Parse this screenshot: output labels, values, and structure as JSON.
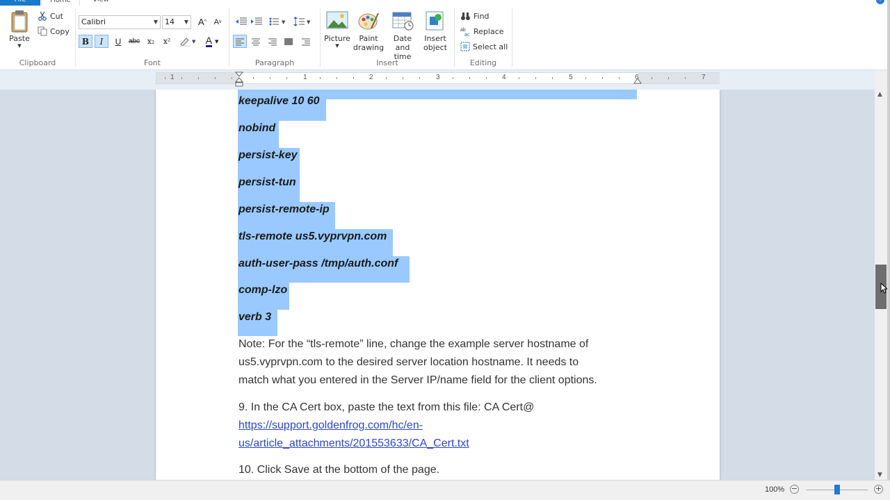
{
  "tabs": {
    "file": "File",
    "home": "Home",
    "view": "View"
  },
  "clipboard": {
    "paste": "Paste",
    "cut": "Cut",
    "copy": "Copy",
    "label": "Clipboard"
  },
  "font": {
    "family": "Calibri",
    "size": "14",
    "label": "Font",
    "bold": "B",
    "italic": "I",
    "underline": "U",
    "strikethrough": "abc",
    "subscript": "x₂",
    "superscript": "x²",
    "color_letter": "A"
  },
  "paragraph": {
    "label": "Paragraph"
  },
  "insert": {
    "picture": "Picture",
    "paint_drawing": [
      "Paint",
      "drawing"
    ],
    "date_time": [
      "Date and",
      "time"
    ],
    "insert_object": [
      "Insert",
      "object"
    ],
    "label": "Insert"
  },
  "editing": {
    "find": "Find",
    "replace": "Replace",
    "select_all": "Select all",
    "label": "Editing"
  },
  "ruler": {
    "numbers": [
      "1",
      "1",
      "2",
      "3",
      "4",
      "5",
      "6",
      "7"
    ]
  },
  "document": {
    "selected_lines": [
      "keepalive 10 60",
      "nobind",
      "persist-key",
      "persist-tun",
      "persist-remote-ip",
      "tls-remote us5.vyprvpn.com",
      "auth-user-pass /tmp/auth.conf",
      "comp-lzo",
      "verb 3"
    ],
    "note_lines": [
      "Note: For the “tls-remote” line, change the example server hostname of",
      "us5.vyprvpn.com to the desired server location hostname. It needs to",
      "match what you entered in the Server IP/name field for the client options."
    ],
    "step9_text": "9. In the CA Cert box, paste the text from this file: CA Cert@",
    "step9_link_lines": [
      "https://support.goldenfrog.com/hc/en-",
      "us/article_attachments/201553633/CA_Cert.txt"
    ],
    "step10_text": "10. Click Save at the bottom of the page."
  },
  "status": {
    "zoom": "100%"
  },
  "colors": {
    "selection": "#99c9ff",
    "accent": "#1979ca",
    "link": "#2b46c9"
  }
}
